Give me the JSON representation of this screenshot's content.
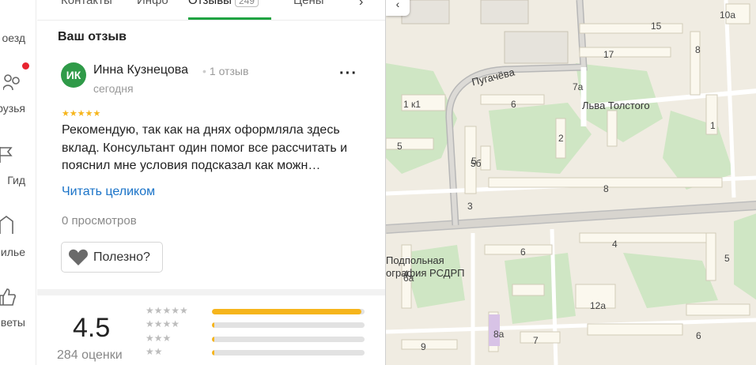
{
  "nav": {
    "items": [
      {
        "label": "оезд",
        "icon": "route-icon"
      },
      {
        "label": "рузья",
        "icon": "friends-icon"
      },
      {
        "label": "Гид",
        "icon": "guide-icon"
      },
      {
        "label": "илье",
        "icon": "housing-icon"
      },
      {
        "label": "веты",
        "icon": "tips-icon"
      }
    ]
  },
  "tabs": {
    "items": [
      "Контакты",
      "Инфо",
      "Отзывы",
      "Цены"
    ],
    "reviews_count": "249"
  },
  "review": {
    "section_title": "Ваш отзыв",
    "avatar_initials": "ИК",
    "author": "Инна Кузнецова",
    "author_reviews": "1 отзыв",
    "date": "сегодня",
    "rating": 5,
    "stars": "★★★★★",
    "text": "Рекомендую, так как на днях оформляла здесь вклад. Консультант один помог все рассчитать и пояснил мне условия подсказал как можн…",
    "read_more": "Читать целиком",
    "views": "0 просмотров",
    "useful_button": "Полезно?"
  },
  "summary": {
    "score": "4.5",
    "count_label": "284 оценки",
    "distribution": [
      {
        "stars": "★★★★★",
        "fraction": 0.98
      },
      {
        "stars": "★★★★",
        "fraction": 0.01
      },
      {
        "stars": "★★★",
        "fraction": 0.01
      },
      {
        "stars": "★★",
        "fraction": 0.01
      }
    ]
  },
  "map": {
    "streets": [
      "Пугачёва",
      "Льва Толстого"
    ],
    "poi": [
      "Подпольная",
      "ография РСДРП"
    ],
    "house_numbers": [
      "15",
      "17",
      "8",
      "10а",
      "7а",
      "1 к1",
      "6",
      "5",
      "2",
      "1",
      "5",
      "5б",
      "3",
      "8",
      "6",
      "4",
      "5",
      "6а",
      "12а",
      "8а",
      "7",
      "9",
      "6",
      "4"
    ]
  },
  "colors": {
    "accent_green": "#1fa341",
    "link_blue": "#1a73c8",
    "star_yellow": "#f6b51c",
    "avatar_green": "#2f9a48",
    "notification_red": "#e8232f"
  }
}
